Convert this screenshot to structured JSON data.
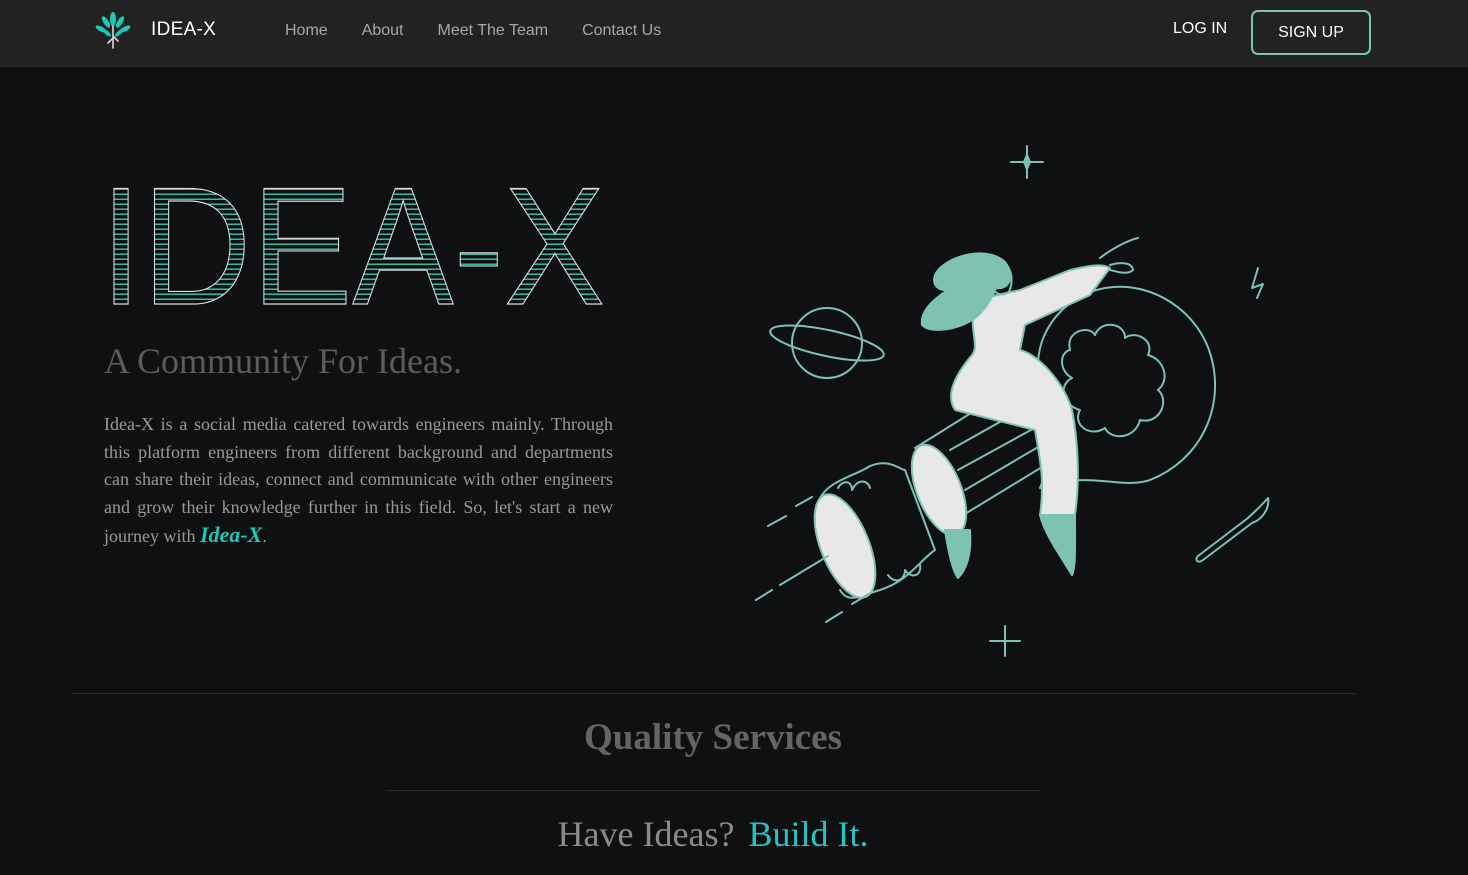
{
  "colors": {
    "navbar_bg": "#222222",
    "page_bg": "#0e1012",
    "accent": "#1cc8b6",
    "illustration_teal": "#7ec2b2"
  },
  "navbar": {
    "logo_icon": "tree-icon",
    "brand": "IDEA-X",
    "links": [
      {
        "label": "Home"
      },
      {
        "label": "About"
      },
      {
        "label": "Meet The Team"
      },
      {
        "label": "Contact Us"
      }
    ],
    "login": "LOG IN",
    "signup": "SIGN UP"
  },
  "hero": {
    "title": "IDEA-X",
    "tagline": "A Community For Ideas.",
    "description": "Idea-X is a social media catered towards engineers mainly. Through this platform engineers from different background and departments can share their ideas, connect and communicate with other engineers and grow their knowledge further in this field. So, let's start a new journey with",
    "description_brand": "Idea-X",
    "description_end": ".",
    "illustration": "woman-riding-lightbulb-rocket-illustration"
  },
  "services": {
    "heading": "Quality Services",
    "question": "Have Ideas?",
    "answer": "Build It."
  }
}
